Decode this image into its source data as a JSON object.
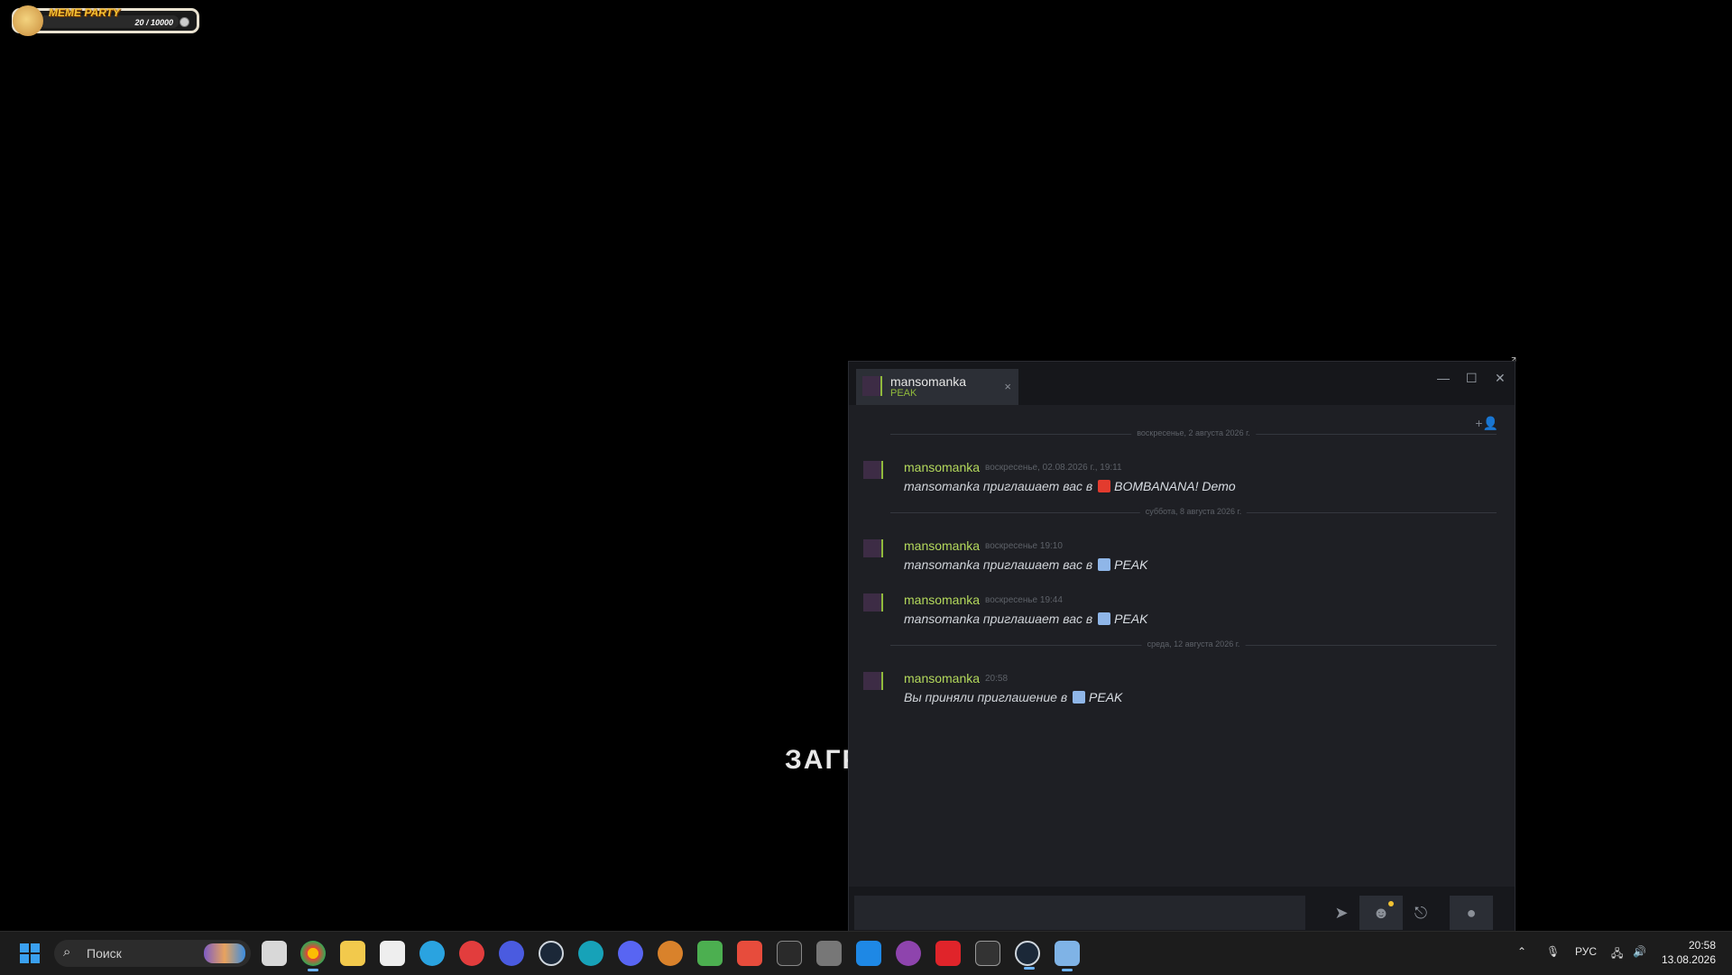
{
  "meme_widget": {
    "title": "MEME PARTY",
    "count": "20 / 10000"
  },
  "loading_text": "ЗАГР",
  "chat": {
    "tab": {
      "name": "mansomanka",
      "game": "PEAK",
      "close": "×"
    },
    "window_buttons": {
      "minimize": "—",
      "maximize": "☐",
      "close": "✕"
    },
    "separators": [
      "воскресенье, 2 августа 2026 г.",
      "суббота, 8 августа 2026 г.",
      "среда, 12 августа 2026 г."
    ],
    "messages": [
      {
        "author": "mansomanka",
        "time": "воскресенье, 02.08.2026 г., 19:11",
        "text": "mansomanka приглашает вас в",
        "game": "BOMBANANA! Demo",
        "icon_color": "#e33b2e"
      },
      {
        "author": "mansomanka",
        "time": "воскресенье 19:10",
        "text": "mansomanka приглашает вас в",
        "game": "PEAK",
        "icon_color": "#8fb6e8"
      },
      {
        "author": "mansomanka",
        "time": "воскресенье 19:44",
        "text": "mansomanka приглашает вас в",
        "game": "PEAK",
        "icon_color": "#8fb6e8"
      },
      {
        "author": "mansomanka",
        "time": "20:58",
        "text": "Вы приняли приглашение в",
        "game": "PEAK",
        "icon_color": "#8fb6e8"
      }
    ]
  },
  "taskbar": {
    "search_placeholder": "Поиск",
    "language": "РУС",
    "time": "20:58",
    "date": "13.08.2026"
  }
}
